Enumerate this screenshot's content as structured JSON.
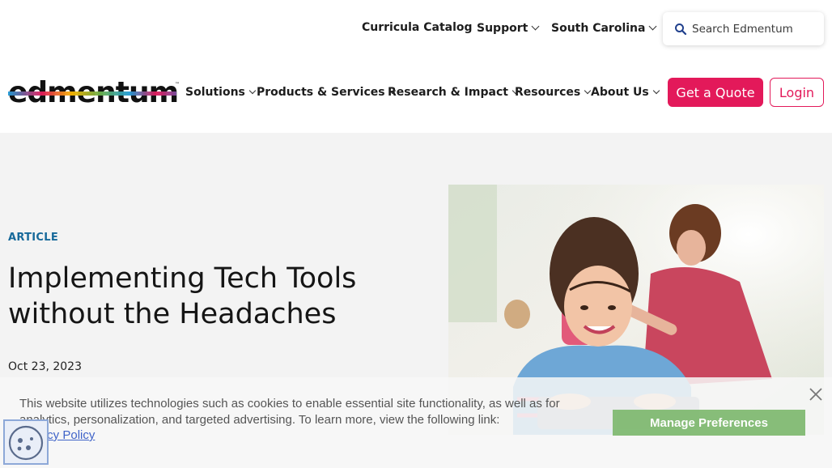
{
  "utility_nav": {
    "curricula_catalog": "Curricula Catalog",
    "support": "Support",
    "region": "South Carolina",
    "search_placeholder": "Search Edmentum"
  },
  "main_nav": {
    "logo_text": "edmentum",
    "items": [
      {
        "label": "Solutions"
      },
      {
        "label": "Products & Services"
      },
      {
        "label": "Research & Impact"
      },
      {
        "label": "Resources"
      },
      {
        "label": "About Us"
      }
    ],
    "quote_label": "Get a Quote",
    "login_label": "Login"
  },
  "article": {
    "eyebrow": "ARTICLE",
    "title": "Implementing Tech Tools without the Headaches",
    "date": "Oct 23, 2023"
  },
  "cookie_banner": {
    "text": "This website utilizes technologies such as cookies to enable essential site functionality, as well as for analytics, personalization, and targeted advertising. To learn more, view the following link:",
    "privacy_link": "Privacy Policy",
    "manage_label": "Manage Preferences"
  },
  "colors": {
    "accent": "#e3195a",
    "eyebrow": "#17699a",
    "manage_button": "#7cb86c",
    "band": "#f3f3f3"
  },
  "icons": {
    "search": "search-icon",
    "close": "close-icon",
    "chevron": "chevron-down-icon",
    "cookie": "cookie-icon"
  }
}
